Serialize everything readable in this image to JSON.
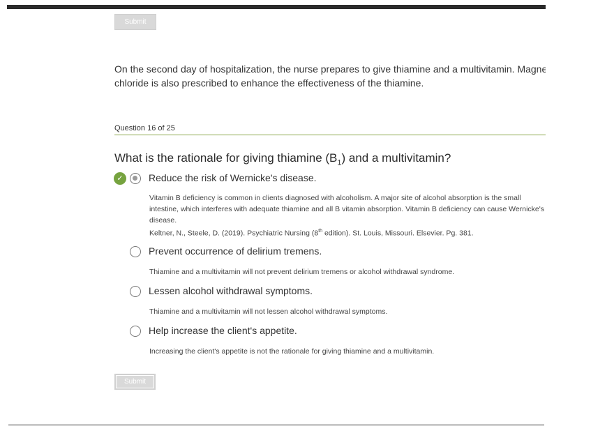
{
  "top_submit_label": "Submit",
  "scenario": {
    "line1": "On the second day of hospitalization, the nurse prepares to give thiamine and a multivitamin. Magnesium",
    "line2": "chloride is also prescribed to enhance the effectiveness of the thiamine."
  },
  "question": {
    "counter": "Question 16 of 25",
    "text_before": "What is the rationale for giving thiamine (B",
    "text_sub": "1",
    "text_after": ") and a multivitamin?"
  },
  "options": [
    {
      "label": "Reduce the risk of Wernicke's disease.",
      "selected": true,
      "correct": true,
      "feedback_lines": [
        "Vitamin B deficiency is common in clients diagnosed with alcoholism. A major site of alcohol absorption is the small",
        "intestine, which interferes with adequate thiamine and all B vitamin absorption. Vitamin B deficiency can cause Wernicke's",
        "disease."
      ],
      "reference_before": "Keltner, N., Steele, D. (2019). Psychiatric Nursing (8",
      "reference_sup": "th",
      "reference_after": " edition). St. Louis, Missouri. Elsevier. Pg. 381."
    },
    {
      "label": "Prevent occurrence of delirium tremens.",
      "selected": false,
      "feedback": "Thiamine and a multivitamin will not prevent delirium tremens or alcohol withdrawal syndrome."
    },
    {
      "label": "Lessen alcohol withdrawal symptoms.",
      "selected": false,
      "feedback": "Thiamine and a multivitamin will not lessen alcohol withdrawal symptoms."
    },
    {
      "label": "Help increase the client's appetite.",
      "selected": false,
      "feedback": "Increasing the client's appetite is not the rationale for giving thiamine and a multivitamin."
    }
  ],
  "bottom_submit_label": "Submit",
  "colors": {
    "accent_green": "#76a33f",
    "rule_green": "#8aa84a",
    "disabled_button": "#d9d9d9"
  },
  "icons": {
    "correct": "check-circle-icon",
    "radio": "radio-icon"
  }
}
